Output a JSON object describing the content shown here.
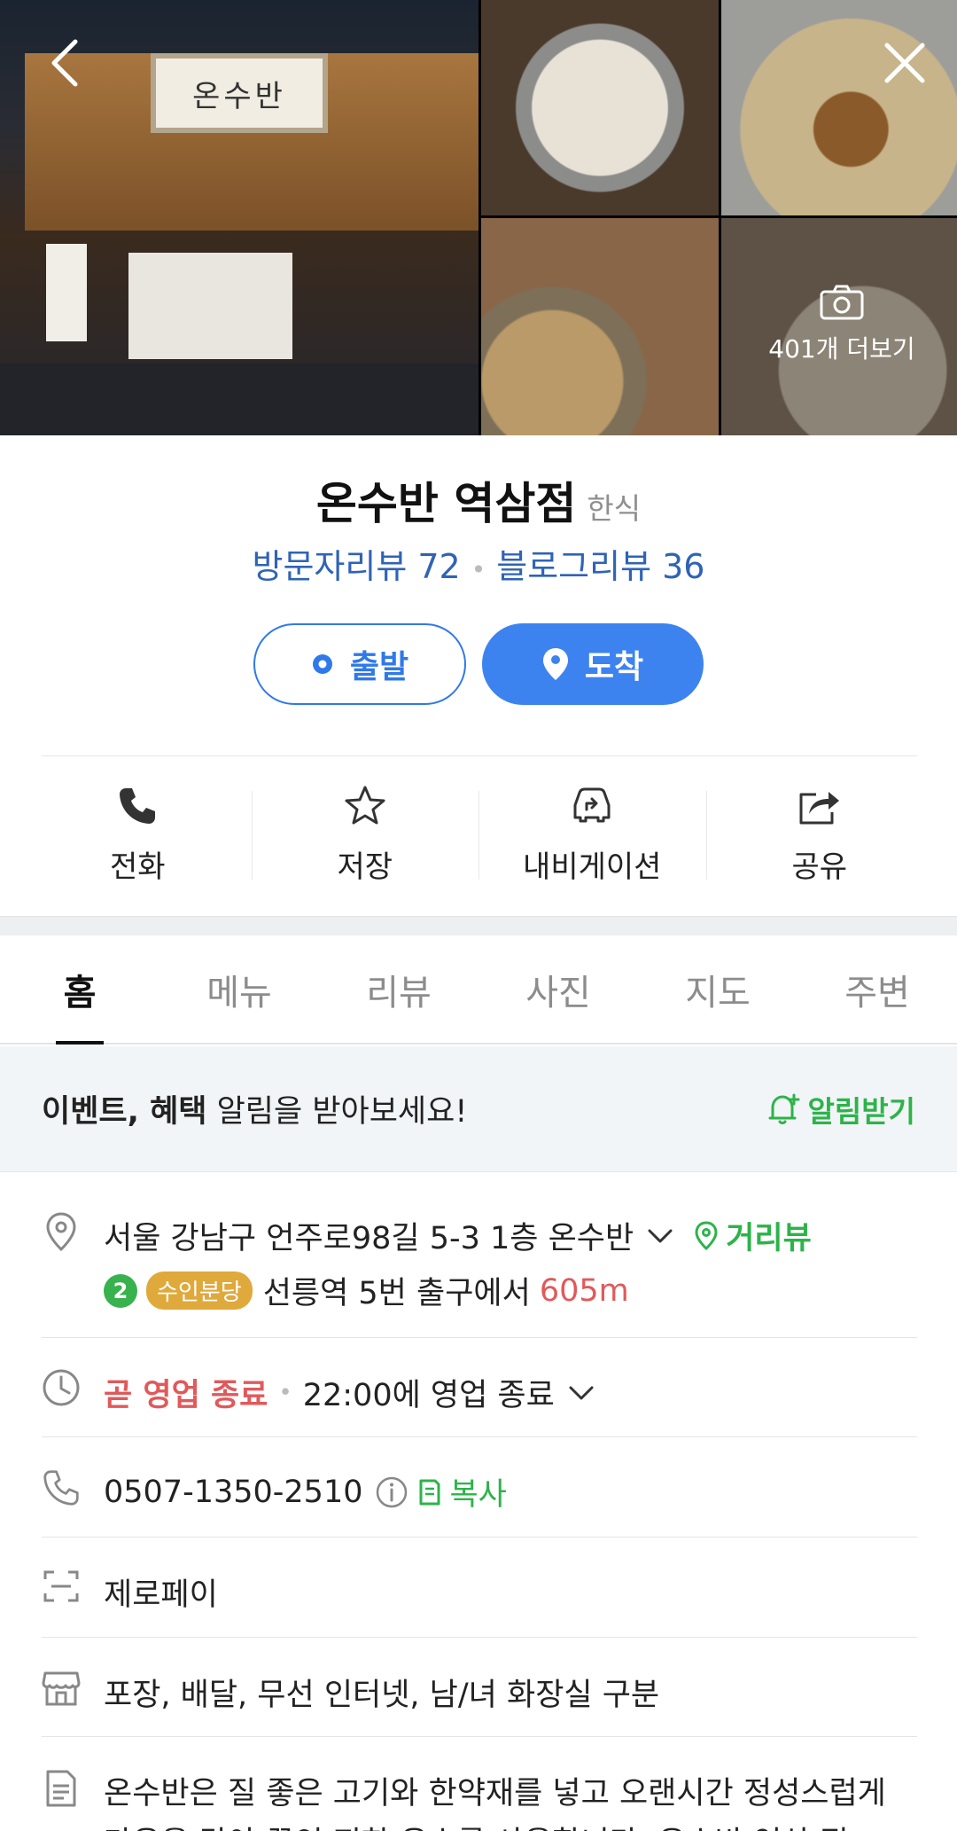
{
  "photos": {
    "more_label": "401개 더보기",
    "main_sign_text": "온수반"
  },
  "place": {
    "name": "온수반 역삼점",
    "category": "한식",
    "visitor_review": "방문자리뷰 72",
    "blog_review": "블로그리뷰 36"
  },
  "directions": {
    "start_label": "출발",
    "arrive_label": "도착"
  },
  "actions": [
    {
      "label": "전화",
      "icon": "phone-icon"
    },
    {
      "label": "저장",
      "icon": "star-icon"
    },
    {
      "label": "내비게이션",
      "icon": "car-icon"
    },
    {
      "label": "공유",
      "icon": "share-icon"
    }
  ],
  "tabs": [
    "홈",
    "메뉴",
    "리뷰",
    "사진",
    "지도",
    "주변"
  ],
  "notify": {
    "bold": "이벤트, 혜택",
    "rest": " 알림을 받아보세요!",
    "button": "알림받기"
  },
  "address": {
    "text": "서울 강남구 언주로98길 5-3 1층 온수반",
    "street_view": "거리뷰",
    "subway_line": "2",
    "line_name": "수인분당",
    "station_text": "선릉역 5번 출구에서",
    "distance": "605m"
  },
  "hours": {
    "status": "곧 영업 종료",
    "detail": "22:00에 영업 종료"
  },
  "phone": {
    "number": "0507-1350-2510",
    "copy": "복사"
  },
  "payment": "제로페이",
  "facilities": "포장, 배달, 무선 인터넷, 남/녀 화장실 구분",
  "description": "온수반은 질 좋은 고기와 한약재를 넣고 오랜시간 정성스럽게 마음을 담아 끓인 진한 육수를 사용합니다. 온수반 역삼 점",
  "colors": {
    "accent_blue": "#3d83f0",
    "link_blue": "#2f63b6",
    "green": "#2db34a",
    "red": "#e1595a",
    "badge_yellow": "#e0a93b"
  }
}
